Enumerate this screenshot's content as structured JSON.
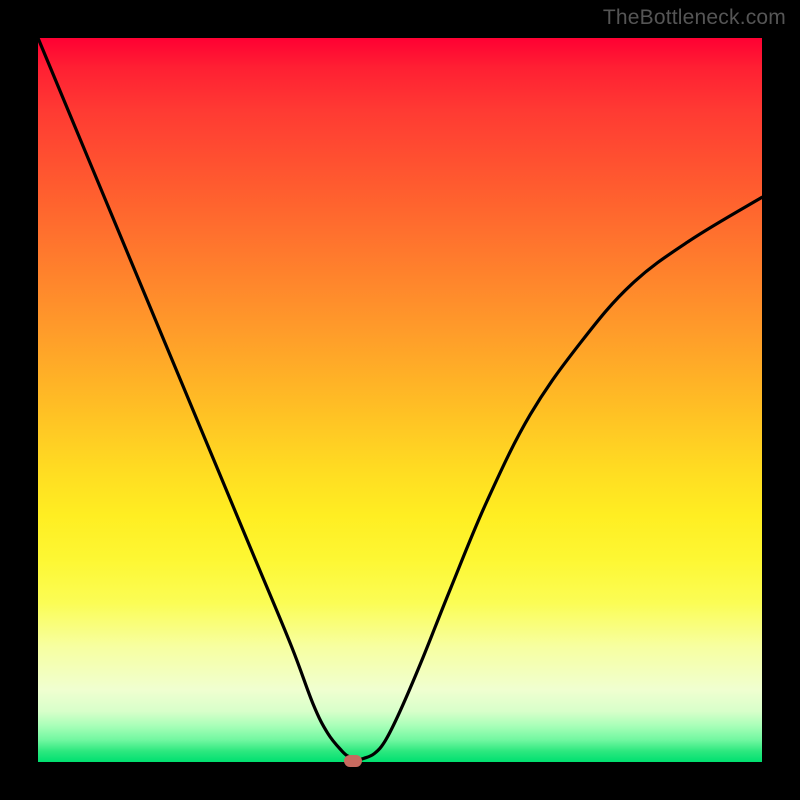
{
  "watermark": "TheBottleneck.com",
  "chart_data": {
    "type": "line",
    "title": "",
    "xlabel": "",
    "ylabel": "",
    "xlim": [
      0,
      100
    ],
    "ylim": [
      0,
      100
    ],
    "series": [
      {
        "name": "bottleneck-curve",
        "x": [
          0,
          5,
          10,
          15,
          20,
          25,
          30,
          35,
          38,
          40,
          42,
          43,
          44,
          45,
          46.5,
          48,
          50,
          53,
          57,
          62,
          68,
          75,
          82,
          90,
          100
        ],
        "values": [
          100,
          88,
          76,
          64,
          52,
          40,
          28,
          16,
          8,
          4,
          1.5,
          0.7,
          0.3,
          0.5,
          1.2,
          3,
          7,
          14,
          24,
          36,
          48,
          58,
          66,
          72,
          78
        ]
      }
    ],
    "marker": {
      "x": 43.5,
      "y": 0.2
    },
    "background_gradient": {
      "top": "#ff0033",
      "mid": "#ffdd22",
      "bottom": "#00e070"
    }
  }
}
